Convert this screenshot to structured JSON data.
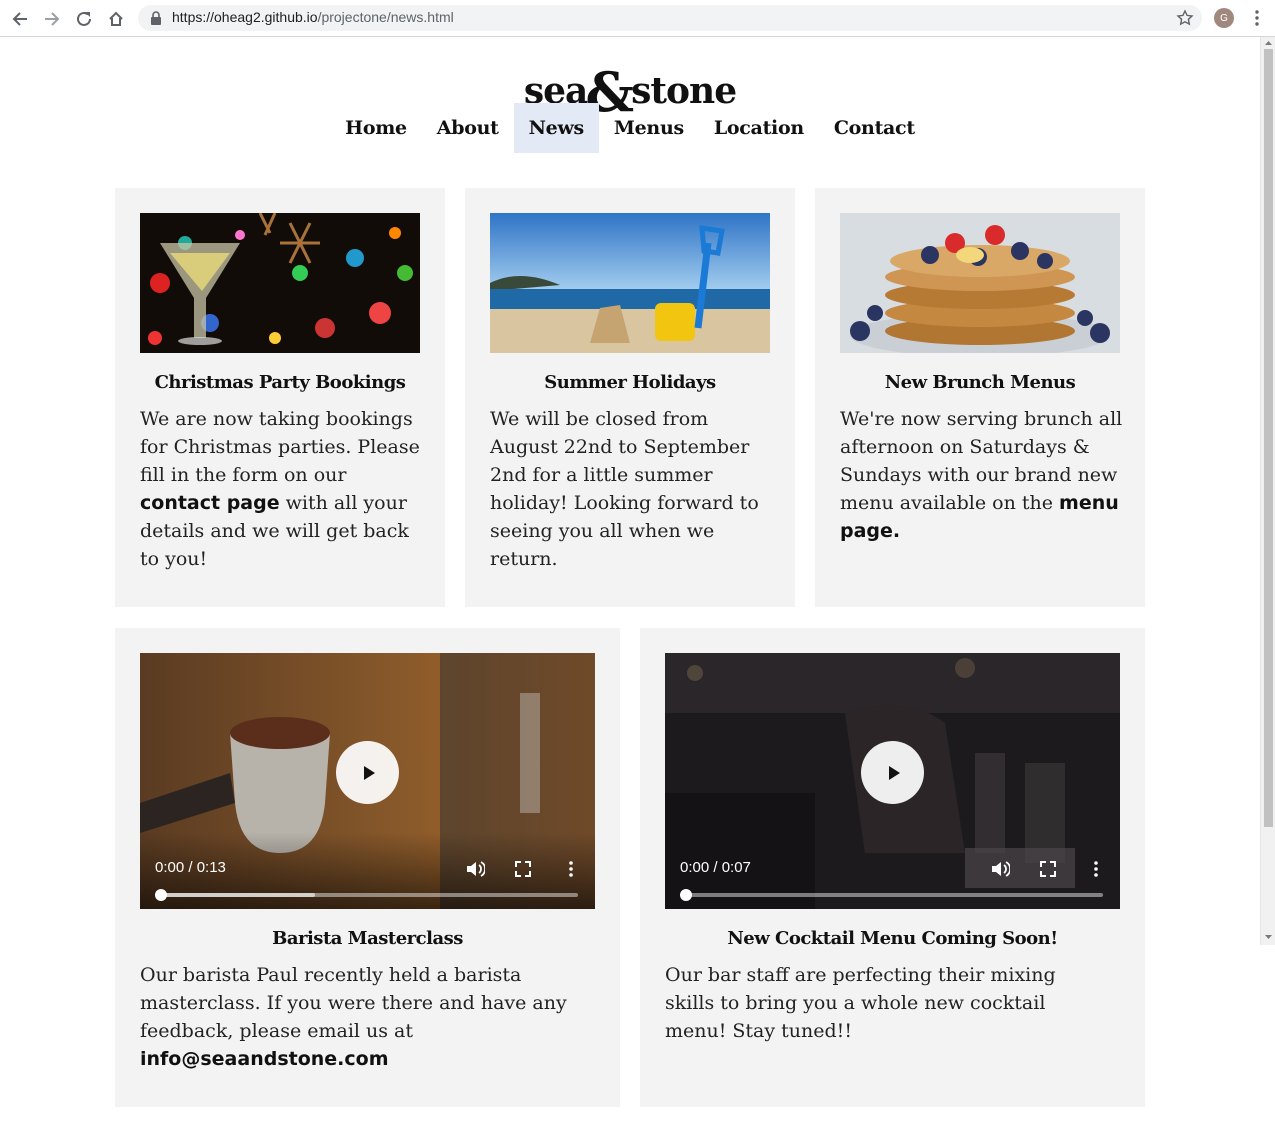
{
  "browser": {
    "url_host": "https://oheag2.github.io",
    "url_path": "/projectone/news.html",
    "avatar_letter": "G"
  },
  "site": {
    "logo_left": "sea",
    "logo_amp": "&",
    "logo_right": "stone"
  },
  "nav": {
    "items": [
      {
        "label": "Home"
      },
      {
        "label": "About"
      },
      {
        "label": "News"
      },
      {
        "label": "Menus"
      },
      {
        "label": "Location"
      },
      {
        "label": "Contact"
      }
    ],
    "active": "News"
  },
  "news": [
    {
      "title": "Christmas Party Bookings",
      "text_before": "We are now taking bookings for Christmas parties. Please fill in the form on our ",
      "link": "contact page",
      "text_after": " with all your details and we will get back to you!"
    },
    {
      "title": "Summer Holidays",
      "text_before": "We will be closed from August 22nd to September 2nd for a little summer holiday! Looking forward to seeing you all when we return.",
      "link": "",
      "text_after": ""
    },
    {
      "title": "New Brunch Menus",
      "text_before": "We're now serving brunch all afternoon on Saturdays & Sundays with our brand new menu available on the ",
      "link": "menu page.",
      "text_after": ""
    }
  ],
  "videos": [
    {
      "title": "Barista Masterclass",
      "time": "0:00 / 0:13",
      "progress": 0,
      "buffered": 0.37,
      "text_before": "Our barista Paul recently held a barista masterclass. If you were there and have any feedback, please email us at ",
      "email": "info@seaandstone.com"
    },
    {
      "title": "New Cocktail Menu Coming Soon!",
      "time": "0:00 / 0:07",
      "progress": 0,
      "buffered": 0,
      "text_before": "Our bar staff are perfecting their mixing skills to bring you a whole new cocktail menu! Stay tuned!!",
      "email": ""
    }
  ],
  "icons": {
    "back": "arrow-left-icon",
    "forward": "arrow-right-icon",
    "reload": "reload-icon",
    "home": "home-icon",
    "lock": "lock-icon",
    "bookmark": "star-icon",
    "menu": "kebab-icon",
    "play": "play-icon",
    "volume": "volume-icon",
    "fullscreen": "fullscreen-icon"
  },
  "colors": {
    "card_bg": "#f3f3f3",
    "nav_active_bg": "#e3e9f5",
    "text": "#111111"
  }
}
